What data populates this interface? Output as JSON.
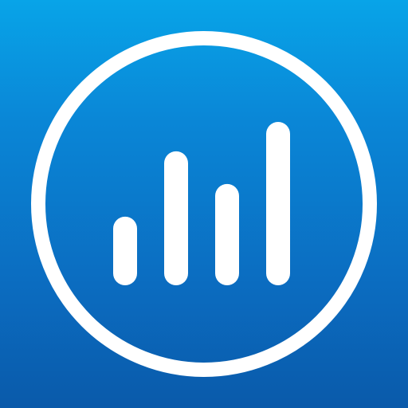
{
  "app_icon": {
    "icon_name": "analytics-bar-chart-icon",
    "colors": {
      "background_top": "#08a4e8",
      "background_bottom": "#0a5aaa",
      "foreground": "#ffffff"
    },
    "bar_levels": [
      0.42,
      0.82,
      0.62,
      1.0
    ]
  }
}
